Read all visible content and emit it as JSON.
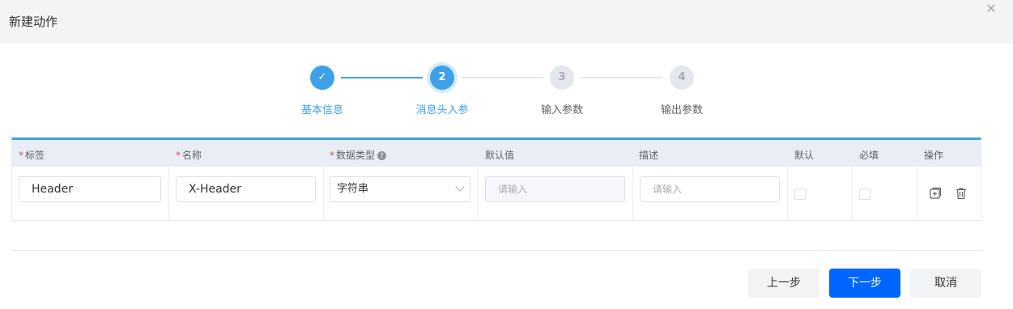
{
  "dialog": {
    "title": "新建动作",
    "close_glyph": "✕"
  },
  "steps": [
    {
      "label": "基本信息",
      "number": "✓",
      "state": "done"
    },
    {
      "label": "消息头入参",
      "number": "2",
      "state": "active"
    },
    {
      "label": "输入参数",
      "number": "3",
      "state": "pending"
    },
    {
      "label": "输出参数",
      "number": "4",
      "state": "pending"
    }
  ],
  "table": {
    "required_mark": "*",
    "columns": [
      "标签",
      "名称",
      "数据类型",
      "默认值",
      "描述",
      "默认",
      "必填",
      "操作"
    ],
    "row": {
      "label_value": "Header",
      "name_value": "X-Header",
      "type_value": "字符串",
      "default_placeholder": "请输入",
      "desc_placeholder": "请输入"
    }
  },
  "buttons": {
    "prev": "上一步",
    "next": "下一步",
    "cancel": "取消"
  },
  "colors": {
    "accent": "#3ea1e8",
    "primary_button": "#0066ff",
    "required": "#e64a3b"
  }
}
